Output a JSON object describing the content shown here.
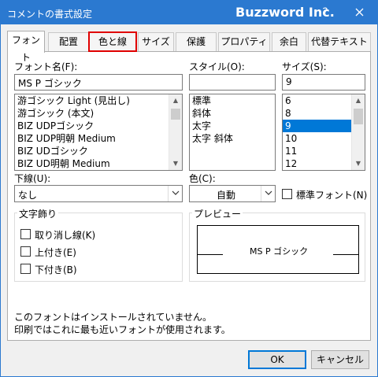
{
  "window": {
    "title": "コメントの書式設定",
    "brand": "Buzzword Inc.",
    "help_label": "?"
  },
  "tabs": [
    {
      "label": "フォント",
      "active": true
    },
    {
      "label": "配置"
    },
    {
      "label": "色と線",
      "highlighted": true
    },
    {
      "label": "サイズ"
    },
    {
      "label": "保護"
    },
    {
      "label": "プロパティ"
    },
    {
      "label": "余白"
    },
    {
      "label": "代替テキスト"
    }
  ],
  "font": {
    "label": "フォント名(F):",
    "value": "MS P ゴシック",
    "items": [
      "游ゴシック Light (見出し)",
      "游ゴシック (本文)",
      "BIZ UDPゴシック",
      "BIZ UDP明朝 Medium",
      "BIZ UDゴシック",
      "BIZ UD明朝 Medium"
    ]
  },
  "style": {
    "label": "スタイル(O):",
    "value": "",
    "items": [
      "標準",
      "斜体",
      "太字",
      "太字 斜体"
    ]
  },
  "size": {
    "label": "サイズ(S):",
    "value": "9",
    "items": [
      "6",
      "8",
      "9",
      "10",
      "11",
      "12"
    ],
    "selected": "9"
  },
  "underline": {
    "label": "下線(U):",
    "value": "なし"
  },
  "color": {
    "label": "色(C):",
    "value": "自動"
  },
  "normal_font": {
    "label": "標準フォント(N)",
    "checked": false
  },
  "effects": {
    "title": "文字飾り",
    "strikethrough": "取り消し線(K)",
    "superscript": "上付き(E)",
    "subscript": "下付き(B)"
  },
  "preview": {
    "title": "プレビュー",
    "sample": "MS P ゴシック"
  },
  "info": {
    "line1": "このフォントはインストールされていません。",
    "line2": "印刷ではこれに最も近いフォントが使用されます。"
  },
  "buttons": {
    "ok": "OK",
    "cancel": "キャンセル"
  },
  "colors": {
    "titlebar": "#2b79d0",
    "selection": "#0078d7",
    "highlight_outline": "#e00000"
  }
}
